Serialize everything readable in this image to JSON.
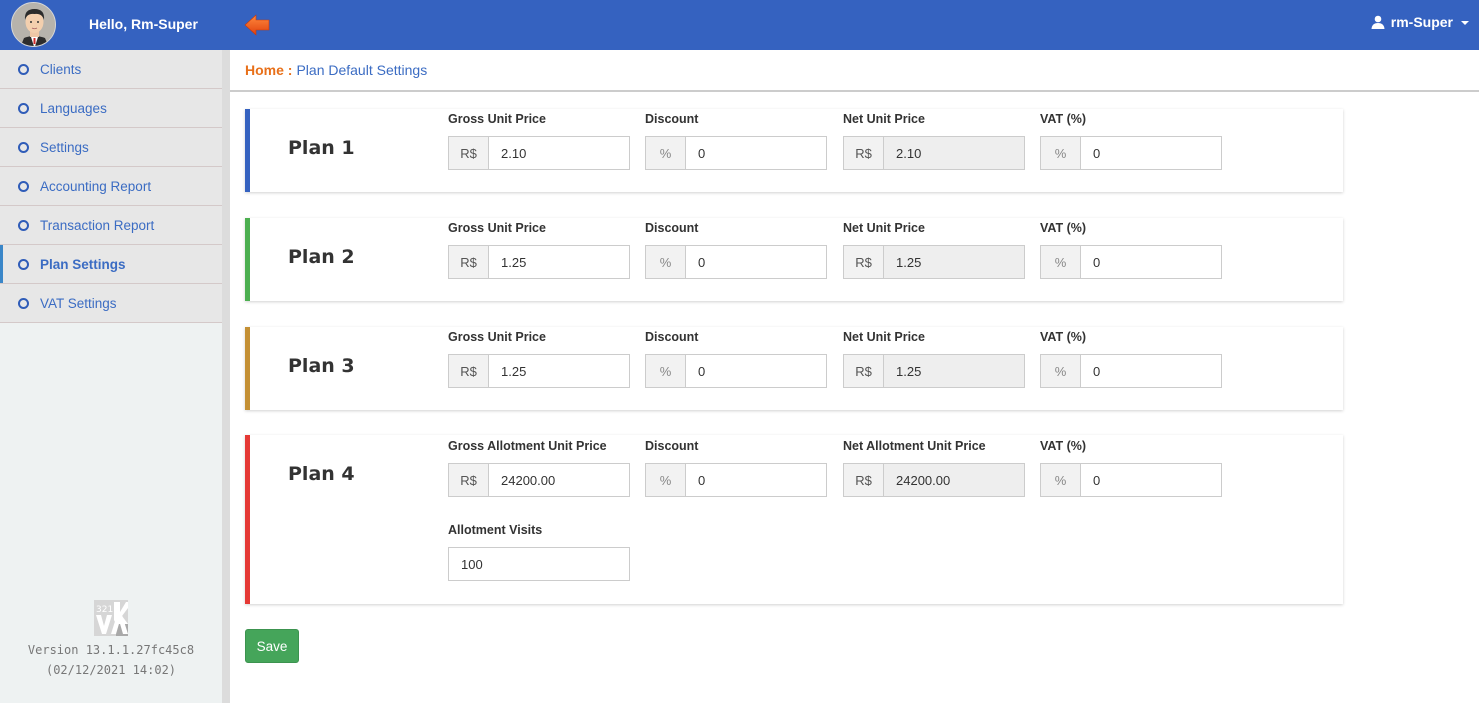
{
  "header": {
    "greeting": "Hello, Rm-Super",
    "user_menu_label": "rm-Super"
  },
  "sidebar": {
    "items": [
      {
        "label": "Clients",
        "active": false
      },
      {
        "label": "Languages",
        "active": false
      },
      {
        "label": "Settings",
        "active": false
      },
      {
        "label": "Accounting Report",
        "active": false
      },
      {
        "label": "Transaction Report",
        "active": false
      },
      {
        "label": "Plan Settings",
        "active": true
      },
      {
        "label": "VAT Settings",
        "active": false
      }
    ],
    "version": "Version 13.1.1.27fc45c8",
    "build_date": "(02/12/2021 14:02)",
    "logo_text": "321"
  },
  "breadcrumb": {
    "home": "Home :",
    "current": "Plan Default Settings"
  },
  "plans": [
    {
      "title": "Plan 1",
      "accent": "#3562c0",
      "gross_label": "Gross Unit Price",
      "gross_value": "2.10",
      "discount_label": "Discount",
      "discount_value": "0",
      "net_label": "Net Unit Price",
      "net_value": "2.10",
      "vat_label": "VAT (%)",
      "vat_value": "0"
    },
    {
      "title": "Plan 2",
      "accent": "#4caf50",
      "gross_label": "Gross Unit Price",
      "gross_value": "1.25",
      "discount_label": "Discount",
      "discount_value": "0",
      "net_label": "Net Unit Price",
      "net_value": "1.25",
      "vat_label": "VAT (%)",
      "vat_value": "0"
    },
    {
      "title": "Plan 3",
      "accent": "#c49034",
      "gross_label": "Gross Unit Price",
      "gross_value": "1.25",
      "discount_label": "Discount",
      "discount_value": "0",
      "net_label": "Net Unit Price",
      "net_value": "1.25",
      "vat_label": "VAT (%)",
      "vat_value": "0"
    },
    {
      "title": "Plan 4",
      "accent": "#e53935",
      "gross_label": "Gross Allotment Unit Price",
      "gross_value": "24200.00",
      "discount_label": "Discount",
      "discount_value": "0",
      "net_label": "Net Allotment Unit Price",
      "net_value": "24200.00",
      "vat_label": "VAT (%)",
      "vat_value": "0",
      "visits_label": "Allotment Visits",
      "visits_value": "100"
    }
  ],
  "currency_symbol": "R$",
  "percent_symbol": "%",
  "save_label": "Save"
}
